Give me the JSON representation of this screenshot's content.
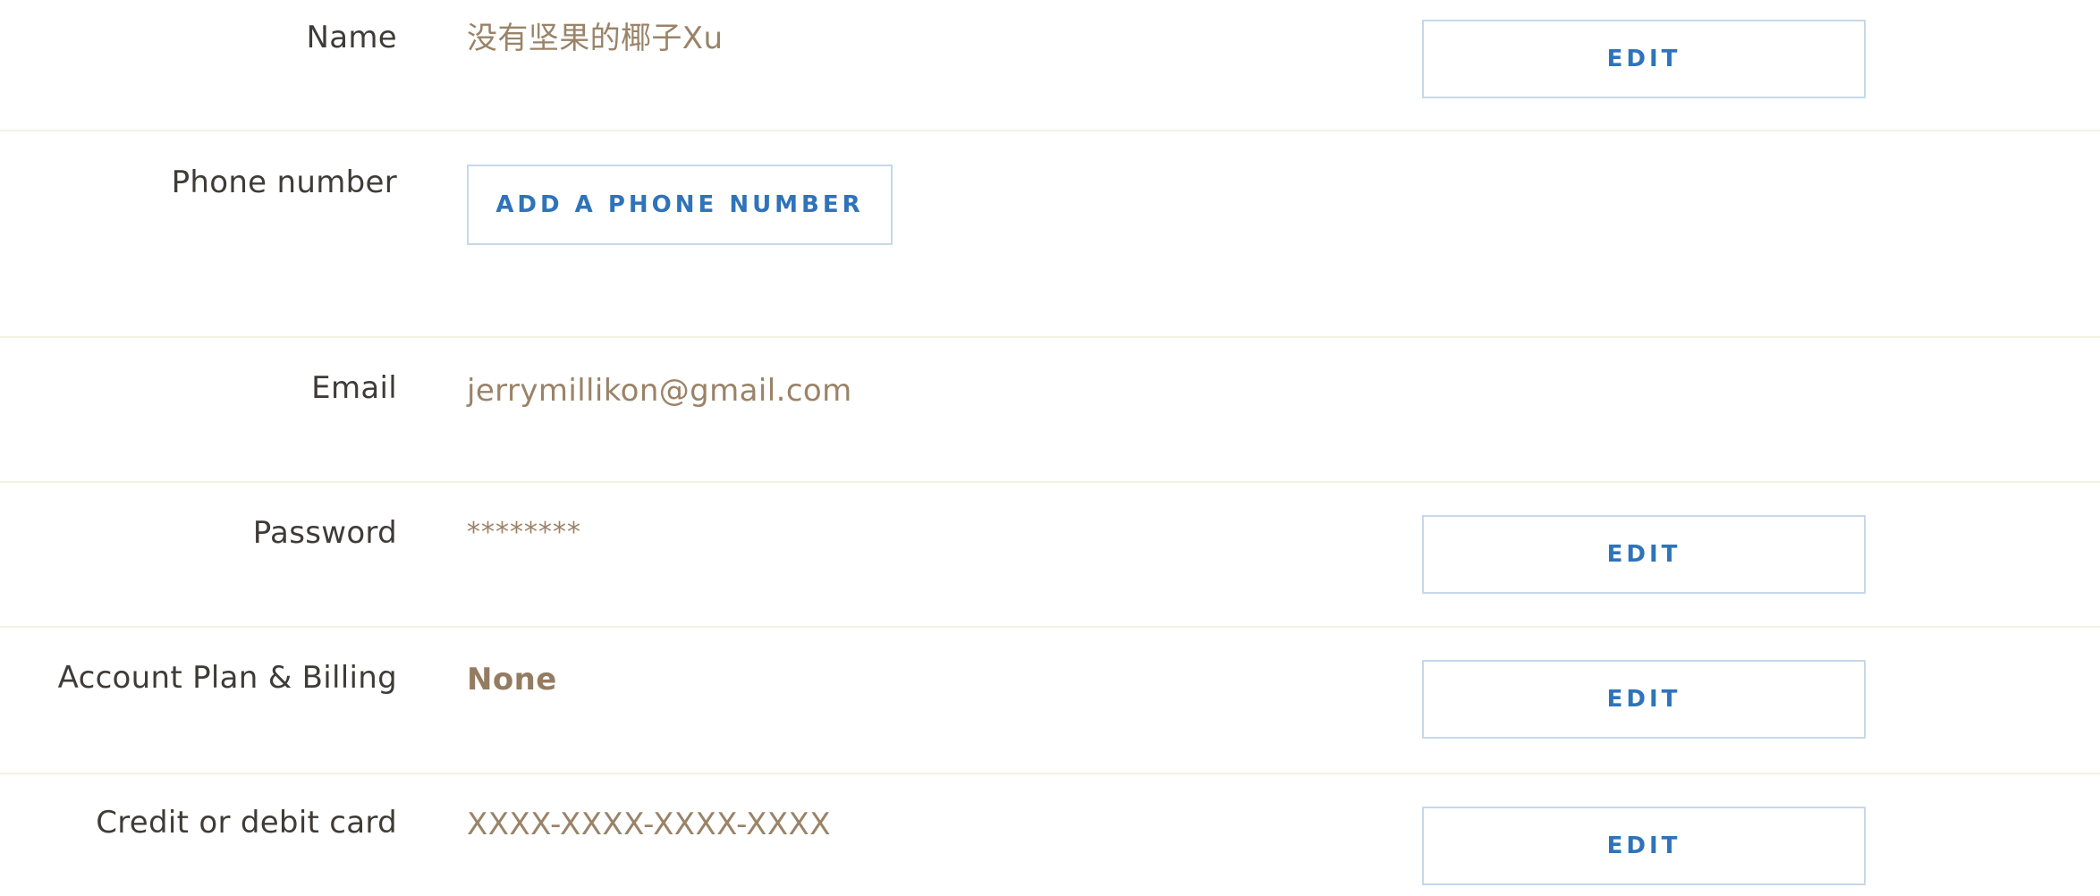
{
  "settings": {
    "name": {
      "label": "Name",
      "value": "没有坚果的椰子Xu",
      "action": "EDIT"
    },
    "phone": {
      "label": "Phone number",
      "action": "ADD A PHONE NUMBER"
    },
    "email": {
      "label": "Email",
      "value": "jerrymillikon@gmail.com"
    },
    "password": {
      "label": "Password",
      "value": "********",
      "action": "EDIT"
    },
    "plan": {
      "label": "Account Plan & Billing",
      "value": "None",
      "action": "EDIT"
    },
    "card": {
      "label": "Credit or debit card",
      "value": "XXXX-XXXX-XXXX-XXXX",
      "action": "EDIT"
    }
  },
  "colors": {
    "label": "#3f3b37",
    "value": "#9a8368",
    "button_text": "#2f73ba",
    "button_border": "#c6d8ea",
    "divider": "#f4f1e2"
  }
}
